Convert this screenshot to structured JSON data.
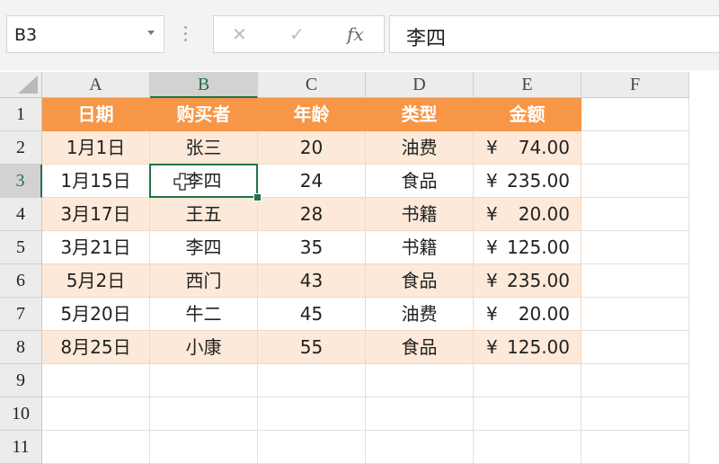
{
  "formula_bar": {
    "name_box": "B3",
    "cancel_icon": "close-icon",
    "enter_icon": "check-icon",
    "function_label": "fx",
    "formula_value": "李四"
  },
  "selection": {
    "column": "B",
    "row": "3",
    "cell": "B3"
  },
  "columns": [
    "A",
    "B",
    "C",
    "D",
    "E",
    "F"
  ],
  "rows": [
    "1",
    "2",
    "3",
    "4",
    "5",
    "6",
    "7",
    "8",
    "9",
    "10",
    "11"
  ],
  "table": {
    "headers": [
      "日期",
      "购买者",
      "年龄",
      "类型",
      "金额"
    ],
    "rows": [
      {
        "date": "1月1日",
        "buyer": "张三",
        "age": "20",
        "type": "油费",
        "currency": "¥",
        "amount": "74.00"
      },
      {
        "date": "1月15日",
        "buyer": "李四",
        "age": "24",
        "type": "食品",
        "currency": "¥",
        "amount": "235.00"
      },
      {
        "date": "3月17日",
        "buyer": "王五",
        "age": "28",
        "type": "书籍",
        "currency": "¥",
        "amount": "20.00"
      },
      {
        "date": "3月21日",
        "buyer": "李四",
        "age": "35",
        "type": "书籍",
        "currency": "¥",
        "amount": "125.00"
      },
      {
        "date": "5月2日",
        "buyer": "西门",
        "age": "43",
        "type": "食品",
        "currency": "¥",
        "amount": "235.00"
      },
      {
        "date": "5月20日",
        "buyer": "牛二",
        "age": "45",
        "type": "油费",
        "currency": "¥",
        "amount": "20.00"
      },
      {
        "date": "8月25日",
        "buyer": "小康",
        "age": "55",
        "type": "食品",
        "currency": "¥",
        "amount": "125.00"
      }
    ]
  },
  "colors": {
    "header_fill": "#f79646",
    "band_fill": "#fde9d9",
    "selection": "#217346"
  }
}
